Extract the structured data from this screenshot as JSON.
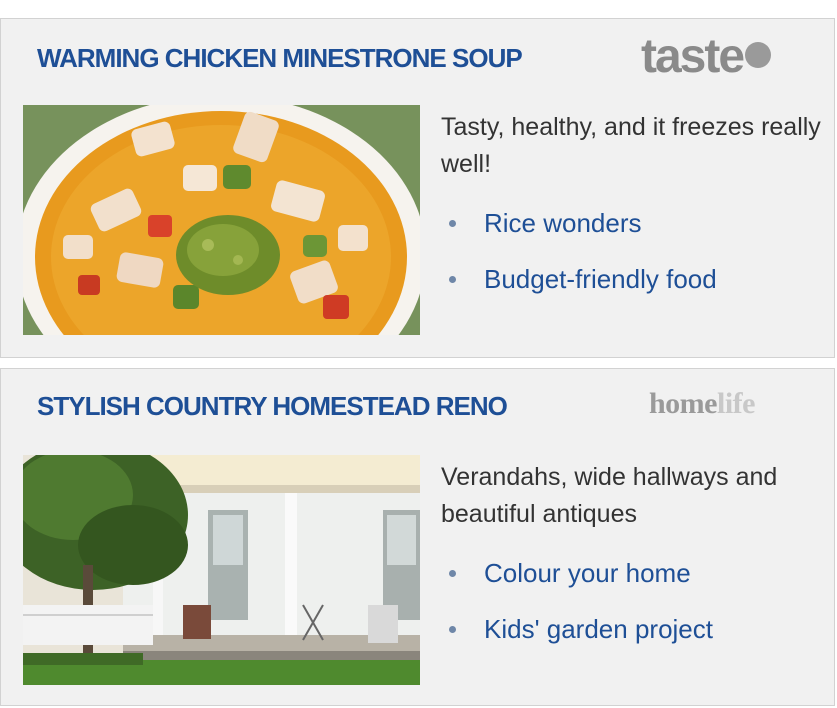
{
  "cards": [
    {
      "headline": "WARMING CHICKEN MINESTRONE SOUP",
      "brand": "taste",
      "image_alt": "chicken minestrone soup bowl",
      "blurb": "Tasty, healthy, and it freezes really well!",
      "links": [
        "Rice wonders",
        "Budget-friendly food"
      ]
    },
    {
      "headline": "STYLISH COUNTRY HOMESTEAD RENO",
      "brand_part1": "home",
      "brand_part2": "life",
      "image_alt": "country homestead with verandah",
      "blurb": "Verandahs, wide hallways and beautiful antiques",
      "links": [
        "Colour your home",
        "Kids' garden project"
      ]
    }
  ],
  "colors": {
    "headline": "#1e4f96",
    "link": "#1e4f96",
    "card_bg": "#f1f1f1",
    "brand_grey": "#8a8a8a"
  }
}
